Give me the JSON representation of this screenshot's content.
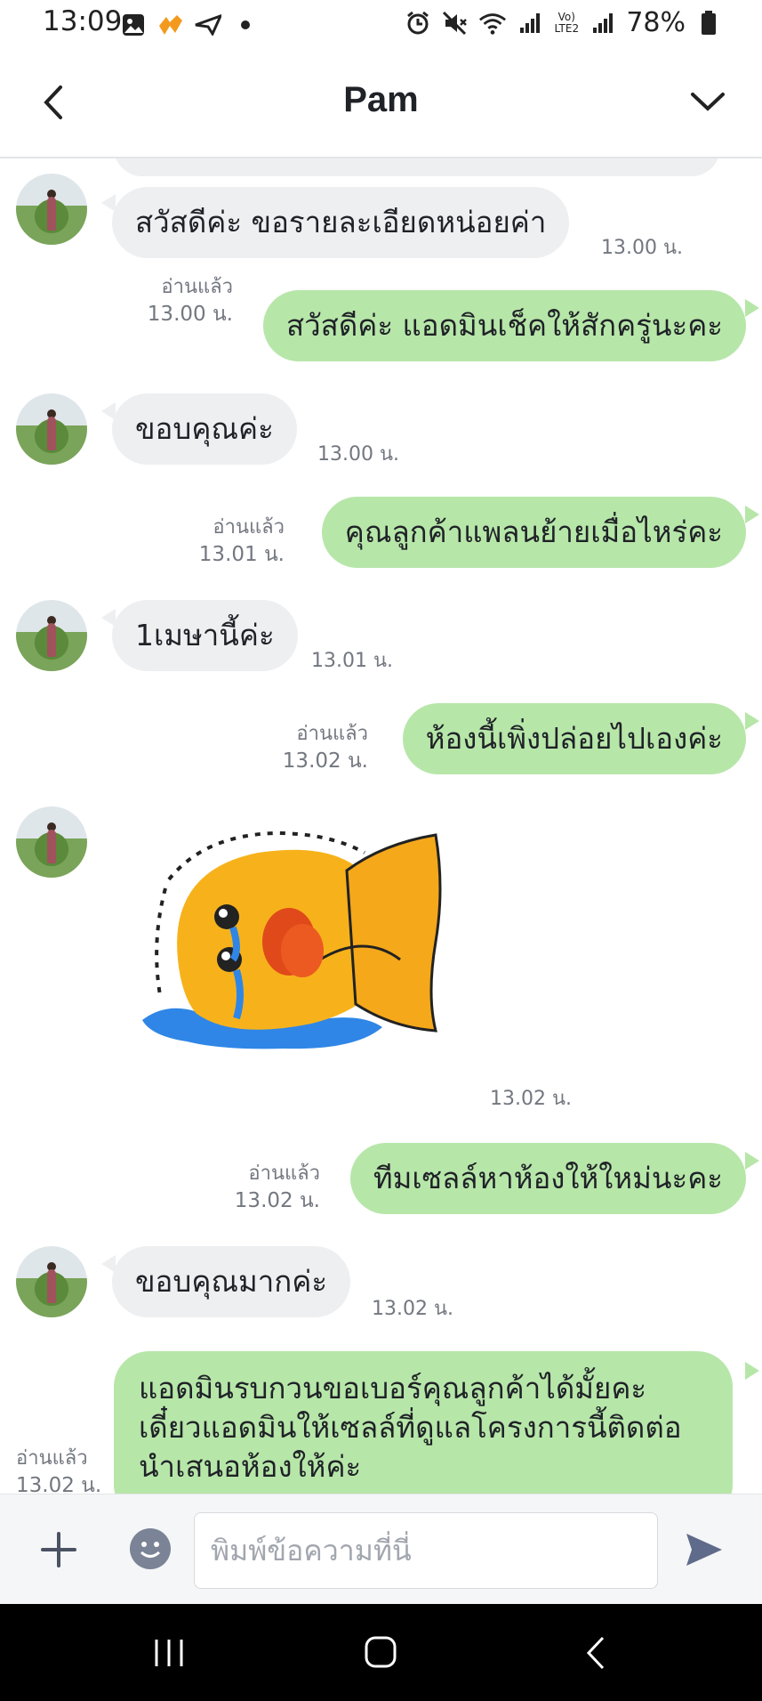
{
  "status_bar": {
    "time": "13:09",
    "battery": "78%",
    "network_label": "Vo) LTE2"
  },
  "header": {
    "title": "Pam"
  },
  "messages": [
    {
      "side": "in",
      "text": "สวัสดีค่ะ ขอรายละเอียดหน่อยค่า",
      "time": "13.00 น."
    },
    {
      "side": "out",
      "text": "สวัสดีค่ะ แอดมินเช็คให้สักครู่นะคะ",
      "read": "อ่านแล้ว",
      "time": "13.00 น."
    },
    {
      "side": "in",
      "text": "ขอบคุณค่ะ",
      "time": "13.00 น."
    },
    {
      "side": "out",
      "text": "คุณลูกค้าแพลนย้ายเมื่อไหร่คะ",
      "read": "อ่านแล้ว",
      "time": "13.01 น."
    },
    {
      "side": "in",
      "text": "1เมษานี้ค่ะ",
      "time": "13.01 น."
    },
    {
      "side": "out",
      "text": "ห้องนี้เพิ่งปล่อยไปเองค่ะ",
      "read": "อ่านแล้ว",
      "time": "13.02 น."
    },
    {
      "side": "in",
      "type": "sticker",
      "sticker": "crying-yellow-fish-sticker",
      "time": "13.02 น."
    },
    {
      "side": "out",
      "text": "ทีมเซลล์หาห้องให้ใหม่นะคะ",
      "read": "อ่านแล้ว",
      "time": "13.02 น."
    },
    {
      "side": "in",
      "text": "ขอบคุณมากค่ะ",
      "time": "13.02 น."
    },
    {
      "side": "out",
      "lines": [
        "แอดมินรบกวนขอเบอร์คุณลูกค้าได้มั้ยคะ",
        "เดี๋ยวแอดมินให้เซลล์ที่ดูแลโครงการนี้ติดต่อ",
        "นำเสนอห้องให้ค่ะ"
      ],
      "read": "อ่านแล้ว",
      "time": "13.02 น."
    }
  ],
  "input_bar": {
    "placeholder": "พิมพ์ข้อความที่นี่"
  },
  "colors": {
    "outgoing_bubble": "#b7e6a9",
    "incoming_bubble": "#eeeff1",
    "meta_text": "#737780"
  }
}
